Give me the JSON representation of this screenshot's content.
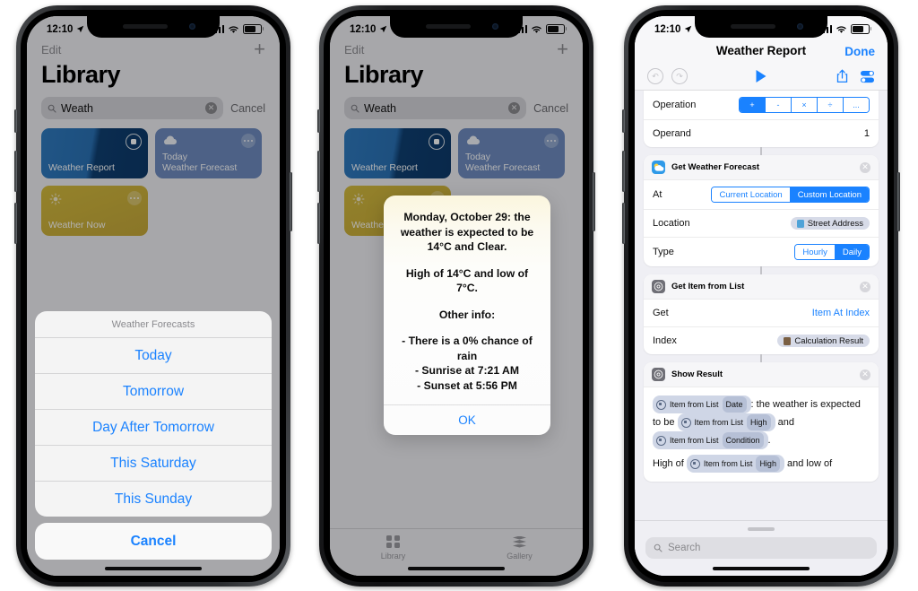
{
  "status_bar": {
    "time": "12:10",
    "location_icon": "location-arrow-icon",
    "signal_icon": "cellular-bars-icon",
    "wifi_icon": "wifi-icon",
    "battery_icon": "battery-icon"
  },
  "library": {
    "edit_label": "Edit",
    "add_label": "+",
    "title": "Library",
    "search": {
      "value": "Weath",
      "placeholder": "Search",
      "clear_label": "✕",
      "cancel_label": "Cancel",
      "icon": "search-icon"
    },
    "cards": [
      {
        "id": "weather-report",
        "line1": "",
        "line2": "Weather Report",
        "badge": "selected",
        "icon": "",
        "color": "#2a72b6"
      },
      {
        "id": "weather-forecast",
        "line1": "Today",
        "line2": "Weather Forecast",
        "badge": "dots",
        "icon": "cloud-icon",
        "color": "#6f8cc0"
      },
      {
        "id": "weather-now",
        "line1": "",
        "line2": "Weather Now",
        "badge": "dots",
        "icon": "sun-icon",
        "color": "#cdb23c"
      }
    ],
    "tabs": [
      {
        "label": "Library",
        "icon": "grid-icon"
      },
      {
        "label": "Gallery",
        "icon": "stack-icon"
      }
    ]
  },
  "action_sheet": {
    "title": "Weather Forecasts",
    "options": [
      "Today",
      "Tomorrow",
      "Day After Tomorrow",
      "This Saturday",
      "This Sunday"
    ],
    "cancel_label": "Cancel"
  },
  "alert": {
    "paragraphs": [
      "Monday, October 29: the weather is expected to be 14°C and Clear.",
      "High of 14°C and low of 7°C.",
      "Other info:",
      "- There is a 0% chance of rain\n- Sunrise at 7:21 AM\n- Sunset at 5:56 PM"
    ],
    "ok_label": "OK"
  },
  "editor": {
    "title": "Weather Report",
    "done_label": "Done",
    "toolbar": {
      "undo_icon": "undo-icon",
      "redo_icon": "redo-icon",
      "run_icon": "play-icon",
      "share_icon": "share-icon",
      "settings_icon": "toggles-icon"
    },
    "calculation_card": {
      "rows": [
        {
          "label": "Operation",
          "control": "segmented",
          "segments": [
            "+",
            "-",
            "×",
            "÷",
            "..."
          ],
          "selected": 0
        },
        {
          "label": "Operand",
          "value": "1"
        }
      ]
    },
    "cards": [
      {
        "title": "Get Weather Forecast",
        "icon": "weather-icon",
        "close_label": "✕",
        "rows": [
          {
            "label": "At",
            "control": "segmented",
            "segments": [
              "Current Location",
              "Custom Location"
            ],
            "selected": 1
          },
          {
            "label": "Location",
            "control": "pill",
            "pill_text": "Street Address",
            "pill_icon": "globe-icon"
          },
          {
            "label": "Type",
            "control": "segmented",
            "segments": [
              "Hourly",
              "Daily"
            ],
            "selected": 1
          }
        ]
      },
      {
        "title": "Get Item from List",
        "icon": "gear-icon",
        "close_label": "✕",
        "rows": [
          {
            "label": "Get",
            "control": "link",
            "value": "Item At Index"
          },
          {
            "label": "Index",
            "control": "pill",
            "pill_text": "Calculation Result",
            "pill_icon": "calculator-icon"
          }
        ]
      },
      {
        "title": "Show Result",
        "icon": "gear-icon",
        "close_label": "✕",
        "result_tokens": [
          {
            "type": "token",
            "name": "Item from List",
            "sub": "Date"
          },
          {
            "type": "text",
            "text": ": the weather is expected to be "
          },
          {
            "type": "token",
            "name": "Item from List",
            "sub": "High"
          },
          {
            "type": "text",
            "text": " and "
          },
          {
            "type": "token",
            "name": "Item from List",
            "sub": "Condition"
          },
          {
            "type": "text",
            "text": "."
          },
          {
            "type": "break"
          },
          {
            "type": "text",
            "text": "High of "
          },
          {
            "type": "token",
            "name": "Item from List",
            "sub": "High"
          },
          {
            "type": "text",
            "text": " and low of"
          }
        ]
      }
    ],
    "search": {
      "placeholder": "Search",
      "icon": "search-icon"
    }
  },
  "colors": {
    "accent": "#1a82ff",
    "card_report": "#2a72b6",
    "card_forecast": "#6f8cc0",
    "card_now": "#cdb23c",
    "bg": "#efeff4"
  }
}
